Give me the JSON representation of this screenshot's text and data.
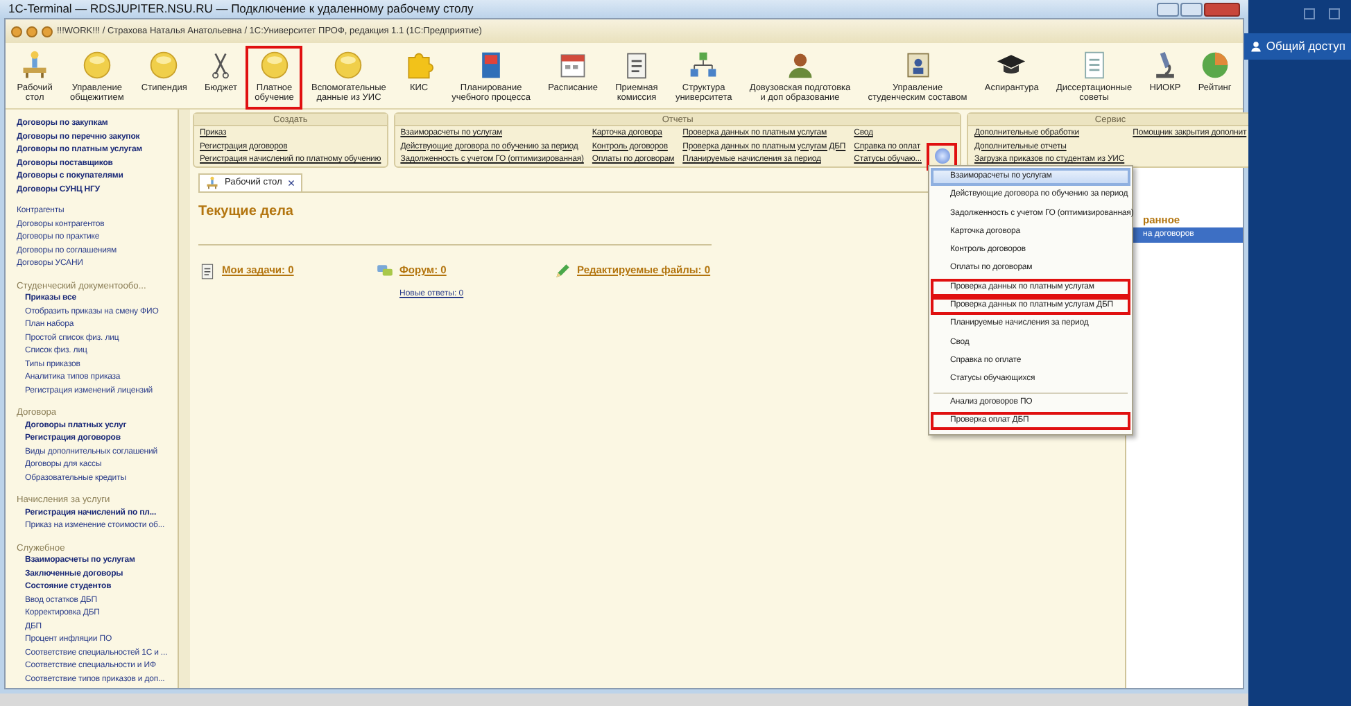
{
  "remote_window": {
    "title": "1C-Terminal — RDSJUPITER.NSU.RU — Подключение к удаленному рабочему столу"
  },
  "app": {
    "title": "!!!WORK!!! / Страхова Наталья Анатольевна / 1С:Университет ПРОФ, редакция 1.1 (1С:Предприятие)"
  },
  "sections": [
    {
      "label": "Рабочий\nстол",
      "kind": "desk",
      "highlighted": false
    },
    {
      "label": "Управление\nобщежитием",
      "kind": "ball",
      "highlighted": false
    },
    {
      "label": "Стипендия",
      "kind": "ball",
      "highlighted": false
    },
    {
      "label": "Бюджет",
      "kind": "scissors",
      "highlighted": false
    },
    {
      "label": "Платное\nобучение",
      "kind": "ball",
      "highlighted": true
    },
    {
      "label": "Вспомогательные\nданные из УИС",
      "kind": "ball",
      "highlighted": false
    },
    {
      "label": "КИС",
      "kind": "puzzle",
      "highlighted": false
    },
    {
      "label": "Планирование\nучебного процесса",
      "kind": "book",
      "highlighted": false
    },
    {
      "label": "Расписание",
      "kind": "calendar",
      "highlighted": false
    },
    {
      "label": "Приемная\nкомиссия",
      "kind": "clipboard",
      "highlighted": false
    },
    {
      "label": "Структура\nуниверситета",
      "kind": "structure",
      "highlighted": false
    },
    {
      "label": "Довузовская подготовка\nи доп образование",
      "kind": "person",
      "highlighted": false
    },
    {
      "label": "Управление\nстуденческим составом",
      "kind": "portrait",
      "highlighted": false
    },
    {
      "label": "Аспирантура",
      "kind": "cap",
      "highlighted": false
    },
    {
      "label": "Диссертационные\nсоветы",
      "kind": "document",
      "highlighted": false
    },
    {
      "label": "НИОКР",
      "kind": "microscope",
      "highlighted": false
    },
    {
      "label": "Рейтинг",
      "kind": "pie",
      "highlighted": false
    }
  ],
  "command_groups": [
    {
      "title": "Создать",
      "columns": [
        [
          "Приказ",
          "Регистрация договоров",
          "Регистрация начислений по платному обучению"
        ]
      ]
    },
    {
      "title": "Отчеты",
      "columns": [
        [
          "Взаиморасчеты по услугам",
          "Действующие договора по обучению за период",
          "Задолженность с учетом ГО (оптимизированная)"
        ],
        [
          "Карточка договора",
          "Контроль договоров",
          "Оплаты по договорам"
        ],
        [
          "Проверка данных по платным услугам",
          "Проверка данных по платным услугам ДБП",
          "Планируемые начисления за период"
        ],
        [
          "Свод",
          "Справка по оплат",
          "Статусы обучаю..."
        ]
      ]
    },
    {
      "title": "Сервис",
      "columns": [
        [
          "Дополнительные обработки",
          "Дополнительные отчеты",
          "Загрузка приказов по студентам из УИС"
        ],
        [
          "Помощник закрытия дополнит"
        ]
      ]
    }
  ],
  "more_button": {
    "highlighted": true
  },
  "sidebar": [
    {
      "items": [
        {
          "label": "Договоры по закупкам",
          "bold": true
        },
        {
          "label": "Договоры по перечню закупок",
          "bold": true
        },
        {
          "label": "Договоры по платным услугам",
          "bold": true
        },
        {
          "label": "Договоры поставщиков",
          "bold": true
        },
        {
          "label": "Договоры с покупателями",
          "bold": true
        },
        {
          "label": "Договоры СУНЦ НГУ",
          "bold": true
        }
      ]
    },
    {
      "items": [
        {
          "label": "Контрагенты",
          "bold": false
        },
        {
          "label": "Договоры контрагентов",
          "bold": false
        },
        {
          "label": "Договоры по практике",
          "bold": false
        },
        {
          "label": "Договоры по соглашениям",
          "bold": false
        },
        {
          "label": "Договоры УСАНИ",
          "bold": false
        }
      ]
    },
    {
      "title": "Студенческий документообо...",
      "items": [
        {
          "label": "Приказы все",
          "bold": true
        },
        {
          "label": "Отобразить приказы на смену ФИО",
          "bold": false
        },
        {
          "label": "План набора",
          "bold": false
        },
        {
          "label": "Простой список физ. лиц",
          "bold": false
        },
        {
          "label": "Список физ. лиц",
          "bold": false
        },
        {
          "label": "Типы приказов",
          "bold": false
        },
        {
          "label": "Аналитика типов приказа",
          "bold": false
        },
        {
          "label": "Регистрация изменений лицензий",
          "bold": false
        }
      ]
    },
    {
      "title": "Договора",
      "items": [
        {
          "label": "Договоры платных услуг",
          "bold": true
        },
        {
          "label": "Регистрация договоров",
          "bold": true
        },
        {
          "label": "Виды дополнительных соглашений",
          "bold": false
        },
        {
          "label": "Договоры для кассы",
          "bold": false
        },
        {
          "label": "Образовательные кредиты",
          "bold": false
        }
      ]
    },
    {
      "title": "Начисления за услуги",
      "items": [
        {
          "label": "Регистрация начислений по пл...",
          "bold": true
        },
        {
          "label": "Приказ на изменение стоимости об...",
          "bold": false
        }
      ]
    },
    {
      "title": "Служебное",
      "items": [
        {
          "label": "Взаиморасчеты по услугам",
          "bold": true
        },
        {
          "label": "Заключенные договоры",
          "bold": true
        },
        {
          "label": "Состояние студентов",
          "bold": true
        },
        {
          "label": "Ввод остатков ДБП",
          "bold": false
        },
        {
          "label": "Корректировка ДБП",
          "bold": false
        },
        {
          "label": "ДБП",
          "bold": false
        },
        {
          "label": "Процент инфляции ПО",
          "bold": false
        },
        {
          "label": "Соответствие специальностей 1С и ...",
          "bold": false
        },
        {
          "label": "Соответствие специальности и ИФ",
          "bold": false
        },
        {
          "label": "Соответствие типов приказов и доп...",
          "bold": false
        }
      ]
    }
  ],
  "tab": {
    "label": "Рабочий стол",
    "close_glyph": "×"
  },
  "desk": {
    "heading": "Текущие дела",
    "widgets": [
      {
        "kind": "tasks",
        "label": "Мои задачи: 0"
      },
      {
        "kind": "forum",
        "label": "Форум: 0",
        "sublink": "Новые ответы: 0"
      },
      {
        "kind": "files",
        "label": "Редактируемые файлы: 0"
      }
    ]
  },
  "right_panel": {
    "heading": "ранное",
    "items": [
      {
        "label": "на договоров",
        "selected": true
      }
    ]
  },
  "dropdown": {
    "items": [
      {
        "label": "Взаиморасчеты по услугам",
        "selected": true,
        "highlighted": false,
        "separated": false
      },
      {
        "label": "Действующие договора по обучению за период",
        "selected": false,
        "highlighted": false,
        "separated": false
      },
      {
        "label": "Задолженность с учетом ГО (оптимизированная)",
        "selected": false,
        "highlighted": false,
        "separated": false
      },
      {
        "label": "Карточка договора",
        "selected": false,
        "highlighted": false,
        "separated": false
      },
      {
        "label": "Контроль договоров",
        "selected": false,
        "highlighted": false,
        "separated": false
      },
      {
        "label": "Оплаты по договорам",
        "selected": false,
        "highlighted": false,
        "separated": false
      },
      {
        "label": "Проверка данных по платным услугам",
        "selected": false,
        "highlighted": true,
        "separated": false
      },
      {
        "label": "Проверка данных по платным услугам ДБП",
        "selected": false,
        "highlighted": true,
        "separated": false
      },
      {
        "label": "Планируемые начисления за период",
        "selected": false,
        "highlighted": false,
        "separated": false
      },
      {
        "label": "Свод",
        "selected": false,
        "highlighted": false,
        "separated": false
      },
      {
        "label": "Справка по оплате",
        "selected": false,
        "highlighted": false,
        "separated": false
      },
      {
        "label": "Статусы обучающихся",
        "selected": false,
        "highlighted": false,
        "separated": false
      },
      {
        "label": "Анализ договоров ПО",
        "selected": false,
        "highlighted": false,
        "separated": true
      },
      {
        "label": "Проверка оплат ДБП",
        "selected": false,
        "highlighted": true,
        "separated": false
      }
    ]
  },
  "share_button": {
    "label": "Общий доступ"
  }
}
